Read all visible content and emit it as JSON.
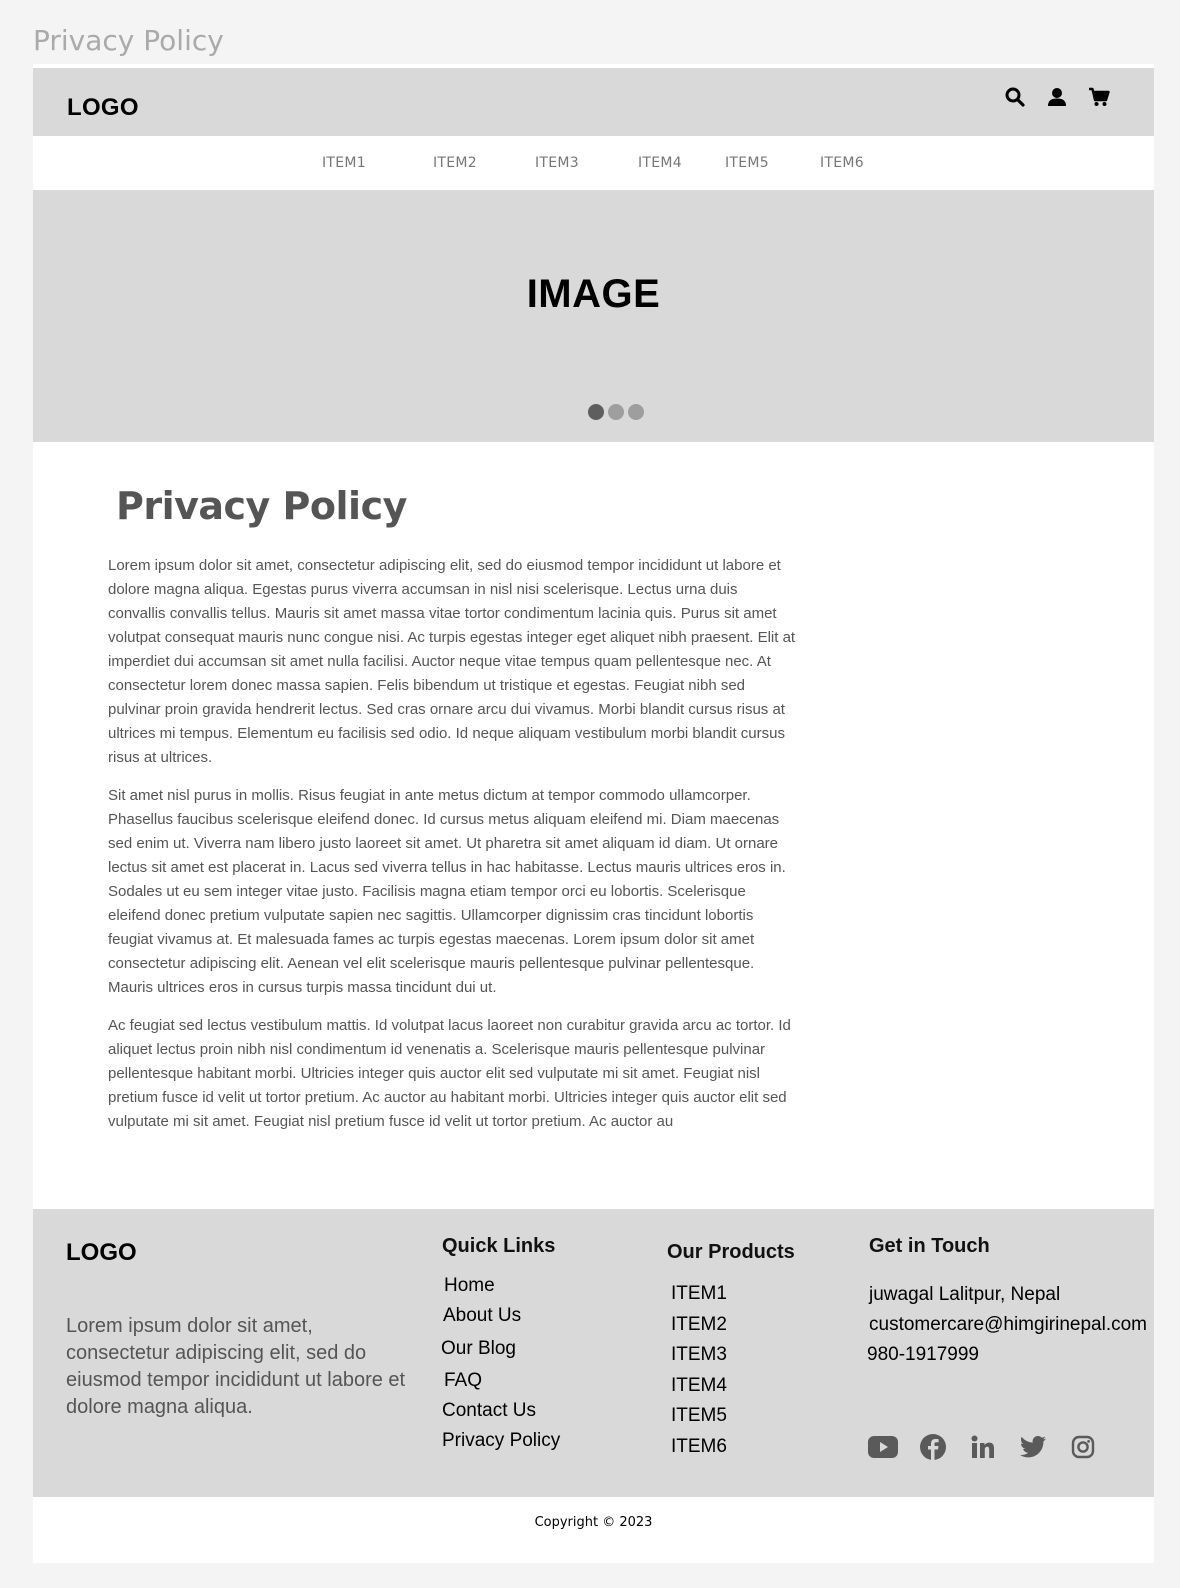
{
  "frame": {
    "title": "Privacy Policy"
  },
  "header": {
    "logo": "LOGO",
    "icons": [
      "search-icon",
      "user-icon",
      "cart-icon"
    ]
  },
  "nav": {
    "items": [
      "ITEM1",
      "ITEM2",
      "ITEM3",
      "ITEM4",
      "ITEM5",
      "ITEM6"
    ]
  },
  "hero": {
    "text": "IMAGE",
    "slides": 3,
    "active_slide": 1
  },
  "main": {
    "title": "Privacy Policy",
    "paragraphs": [
      "Lorem ipsum dolor sit amet, consectetur adipiscing elit, sed do eiusmod tempor incididunt ut labore et dolore magna aliqua. Egestas purus viverra accumsan in nisl nisi scelerisque. Lectus urna duis convallis convallis tellus. Mauris sit amet massa vitae tortor condimentum lacinia quis. Purus sit amet volutpat consequat mauris nunc congue nisi. Ac turpis egestas integer eget aliquet nibh praesent. Elit at imperdiet dui accumsan sit amet nulla facilisi. Auctor neque vitae tempus quam pellentesque nec. At consectetur lorem donec massa sapien. Felis bibendum ut tristique et egestas. Feugiat nibh sed pulvinar proin gravida hendrerit lectus. Sed cras ornare arcu dui vivamus. Morbi blandit cursus risus at ultrices mi tempus. Elementum eu facilisis sed odio. Id neque aliquam vestibulum morbi blandit cursus risus at ultrices.",
      "Sit amet nisl purus in mollis. Risus feugiat in ante metus dictum at tempor commodo ullamcorper. Phasellus faucibus scelerisque eleifend donec. Id cursus metus aliquam eleifend mi. Diam maecenas sed enim ut. Viverra nam libero justo laoreet sit amet. Ut pharetra sit amet aliquam id diam. Ut ornare lectus sit amet est placerat in. Lacus sed viverra tellus in hac habitasse. Lectus mauris ultrices eros in. Sodales ut eu sem integer vitae justo. Facilisis magna etiam tempor orci eu lobortis. Scelerisque eleifend donec pretium vulputate sapien nec sagittis. Ullamcorper dignissim cras tincidunt lobortis feugiat vivamus at. Et malesuada fames ac turpis egestas maecenas. Lorem ipsum dolor sit amet consectetur adipiscing elit. Aenean vel elit scelerisque mauris pellentesque pulvinar pellentesque. Mauris ultrices eros in cursus turpis massa tincidunt dui ut.",
      "Ac feugiat sed lectus vestibulum mattis. Id volutpat lacus laoreet non curabitur gravida arcu ac tortor. Id aliquet lectus proin nibh nisl condimentum id venenatis a. Scelerisque mauris pellentesque pulvinar pellentesque habitant morbi. Ultricies integer quis auctor elit sed vulputate mi sit amet. Feugiat nisl pretium fusce id velit ut tortor pretium. Ac auctor au habitant morbi. Ultricies integer quis auctor elit sed vulputate mi sit amet. Feugiat nisl pretium fusce id velit ut tortor pretium. Ac auctor au"
    ]
  },
  "footer": {
    "logo": "LOGO",
    "description": "Lorem ipsum dolor sit amet, consectetur adipiscing elit, sed do eiusmod tempor incididunt ut labore et dolore magna aliqua.",
    "quick_links": {
      "title": "Quick Links",
      "items": [
        "Home",
        "About Us",
        "Our Blog",
        "FAQ",
        "Contact Us",
        "Privacy Policy"
      ]
    },
    "products": {
      "title": "Our Products",
      "items": [
        "ITEM1",
        "ITEM2",
        "ITEM3",
        "ITEM4",
        "ITEM5",
        "ITEM6"
      ]
    },
    "contact": {
      "title": "Get in Touch",
      "address": "juwagal Lalitpur, Nepal",
      "email": "customercare@himgirinepal.com",
      "phone": "980-1917999"
    },
    "social": [
      "youtube-icon",
      "facebook-icon",
      "linkedin-icon",
      "twitter-icon",
      "instagram-icon"
    ]
  },
  "copyright": "Copyright © 2023",
  "colors": {
    "page_bg": "#f4f4f4",
    "block_gray": "#d9d9d9",
    "text_gray": "#555555",
    "dot_active": "#5e5e5e",
    "dot_inactive": "#9e9e9e"
  }
}
